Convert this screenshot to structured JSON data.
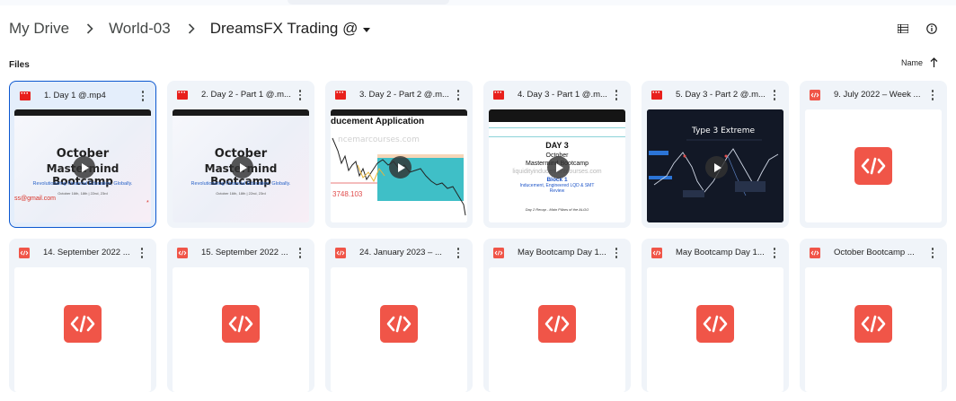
{
  "breadcrumb": {
    "items": [
      "My Drive",
      "World-03"
    ],
    "current": "DreamsFX Trading @"
  },
  "section_label": "Files",
  "sort": {
    "label": "Name"
  },
  "icons": {
    "separator": "chevron-right-icon",
    "list_view": "list-view-icon",
    "info": "info-icon",
    "sort_direction": "arrow-up-icon",
    "video_type": "video-file-icon",
    "code_type": "code-file-icon"
  },
  "colors": {
    "video_icon": "#e8201c",
    "code_icon": "#f05548",
    "selected_border": "#0b57d0"
  },
  "files": [
    {
      "title": "1. Day 1 @.mp4",
      "type": "video",
      "selected": true,
      "preview": {
        "headline_1": "October",
        "headline_2": "Mastermind Bootcamp",
        "tagline": "Revolutionizing Financial Education, Globally.",
        "dates": "October 16th, 18th | 22nd, 23rd",
        "email": "ss@gmail.com"
      }
    },
    {
      "title": "2. Day 2 - Part 1 @.m...",
      "type": "video",
      "selected": false,
      "preview": {
        "headline_1": "October",
        "headline_2": "Mastermind Bootcamp",
        "tagline": "Revolutionizing Financial Education, Globally.",
        "dates": "October 16th, 18th | 22nd, 23rd"
      }
    },
    {
      "title": "3. Day 2 - Part 2 @.m...",
      "type": "video",
      "selected": false,
      "preview": {
        "heading": "ducement Application",
        "watermark": "ncemarcourses.com",
        "price": "3748.103"
      }
    },
    {
      "title": "4. Day 3 - Part 1 @.m...",
      "type": "video",
      "selected": false,
      "preview": {
        "day": "DAY 3",
        "line_1": "October",
        "line_2": "Mastermind Bootcamp",
        "block": "Block 1",
        "topic_1": "Inducement, Engineered LQD & SMT",
        "topic_2": "Review",
        "watermark": "liquidityinducementcourses.com",
        "footer": "Day 2 Recap - Main Pillars of the ALGO"
      }
    },
    {
      "title": "5. Day 3 - Part 2 @.m...",
      "type": "video",
      "selected": false,
      "preview": {
        "heading": "Type 3 Extreme"
      }
    },
    {
      "title": "9. July 2022 – Week ...",
      "type": "code",
      "selected": false
    },
    {
      "title": "14. September 2022 ...",
      "type": "code",
      "selected": false
    },
    {
      "title": "15. September 2022 ...",
      "type": "code",
      "selected": false
    },
    {
      "title": "24. January 2023 – ...",
      "type": "code",
      "selected": false
    },
    {
      "title": "May Bootcamp Day 1...",
      "type": "code",
      "selected": false
    },
    {
      "title": "May Bootcamp Day 1...",
      "type": "code",
      "selected": false
    },
    {
      "title": "October Bootcamp ...",
      "type": "code",
      "selected": false
    }
  ]
}
